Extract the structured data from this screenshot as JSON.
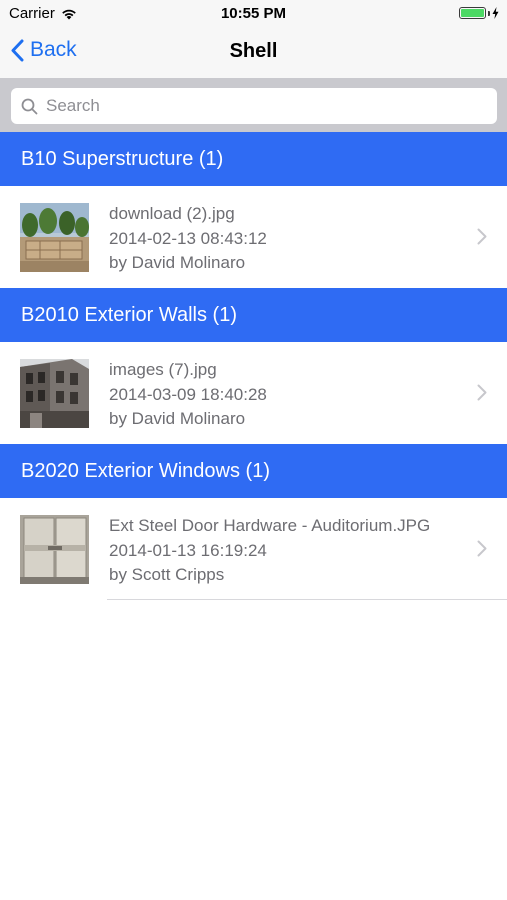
{
  "status": {
    "carrier": "Carrier",
    "time": "10:55 PM"
  },
  "nav": {
    "back_label": "Back",
    "title": "Shell"
  },
  "search": {
    "placeholder": "Search"
  },
  "sections": [
    {
      "header": "B10 Superstructure (1)",
      "item": {
        "filename": "download (2).jpg",
        "datetime": "2014-02-13 08:43:12",
        "author": "by David Molinaro",
        "thumb": "construction-site-photo"
      }
    },
    {
      "header": "B2010 Exterior Walls (1)",
      "item": {
        "filename": "images (7).jpg",
        "datetime": "2014-03-09 18:40:28",
        "author": "by David Molinaro",
        "thumb": "building-facade-photo"
      }
    },
    {
      "header": "B2020 Exterior Windows (1)",
      "item": {
        "filename": "Ext Steel Door Hardware - Auditorium.JPG",
        "datetime": "2014-01-13 16:19:24",
        "author": "by Scott Cripps",
        "thumb": "steel-door-photo"
      }
    }
  ],
  "colors": {
    "accent": "#1e6ff0",
    "section_header_bg": "#2f6bf3",
    "battery": "#4cd964"
  }
}
